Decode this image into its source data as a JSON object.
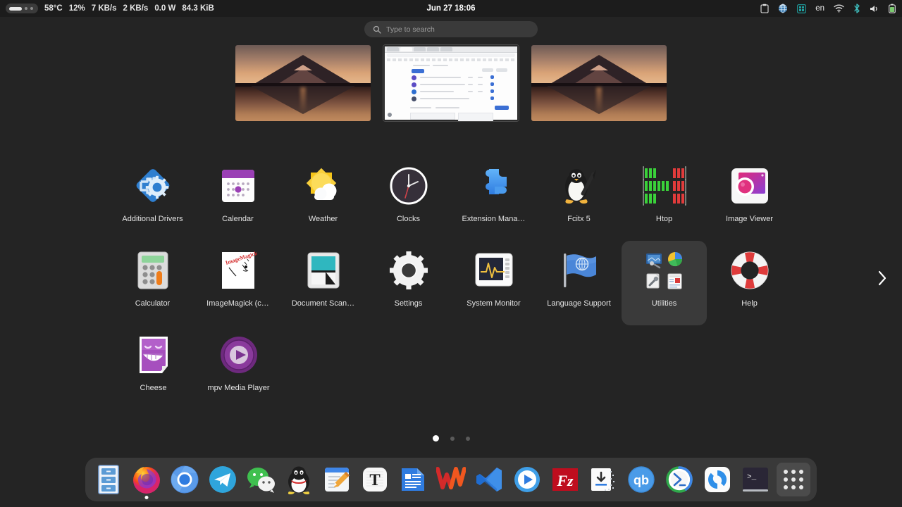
{
  "topbar": {
    "workspace_indicator": "workspace-switcher",
    "stats": [
      {
        "name": "cpu-temperature",
        "value": "58°C"
      },
      {
        "name": "cpu-usage",
        "value": "12%"
      },
      {
        "name": "net-download-speed",
        "value": "7 KB/s"
      },
      {
        "name": "net-upload-speed",
        "value": "2 KB/s"
      },
      {
        "name": "power-draw",
        "value": "0.0 W"
      },
      {
        "name": "memory-usage",
        "value": "84.3 KiB"
      }
    ],
    "clock": "Jun 27  18:06",
    "tray": {
      "clipboard": "clipboard-icon",
      "globe": "network-globe-icon",
      "grid": "extension-grid-icon",
      "language": "en",
      "wifi": "wifi-icon",
      "bluetooth": "bluetooth-icon",
      "volume": "volume-icon",
      "battery": "battery-icon"
    }
  },
  "search": {
    "placeholder": "Type to search",
    "icon": "search-icon"
  },
  "workspaces": [
    {
      "name": "workspace-1",
      "content": "wallpaper",
      "active": false
    },
    {
      "name": "workspace-2",
      "content": "browser-window",
      "active": true
    },
    {
      "name": "workspace-3",
      "content": "wallpaper",
      "active": false
    }
  ],
  "apps": {
    "rows": [
      [
        {
          "label": "Additional Drivers",
          "icon": "additional-drivers-icon",
          "type": "app"
        },
        {
          "label": "Calendar",
          "icon": "calendar-icon",
          "type": "app"
        },
        {
          "label": "Weather",
          "icon": "weather-icon",
          "type": "app"
        },
        {
          "label": "Clocks",
          "icon": "clocks-icon",
          "type": "app"
        },
        {
          "label": "Extension Mana…",
          "icon": "extension-manager-icon",
          "type": "app"
        },
        {
          "label": "Fcitx 5",
          "icon": "fcitx5-icon",
          "type": "app"
        },
        {
          "label": "Htop",
          "icon": "htop-icon",
          "type": "app"
        },
        {
          "label": "Image Viewer",
          "icon": "image-viewer-icon",
          "type": "app"
        }
      ],
      [
        {
          "label": "Calculator",
          "icon": "calculator-icon",
          "type": "app"
        },
        {
          "label": "ImageMagick (c…",
          "icon": "imagemagick-icon",
          "type": "app"
        },
        {
          "label": "Document Scan…",
          "icon": "document-scanner-icon",
          "type": "app"
        },
        {
          "label": "Settings",
          "icon": "settings-icon",
          "type": "app"
        },
        {
          "label": "System Monitor",
          "icon": "system-monitor-icon",
          "type": "app"
        },
        {
          "label": "Language Support",
          "icon": "language-support-icon",
          "type": "app"
        },
        {
          "label": "Utilities",
          "icon": "utilities-folder-icon",
          "type": "folder"
        },
        {
          "label": "Help",
          "icon": "help-icon",
          "type": "app"
        }
      ],
      [
        {
          "label": "Cheese",
          "icon": "cheese-icon",
          "type": "app"
        },
        {
          "label": "mpv Media Player",
          "icon": "mpv-icon",
          "type": "app"
        }
      ]
    ]
  },
  "pagination": {
    "pages": 3,
    "current": 1,
    "next_label": "next-page"
  },
  "dock": {
    "items": [
      {
        "name": "files",
        "icon": "files-icon",
        "running": false
      },
      {
        "name": "firefox",
        "icon": "firefox-icon",
        "running": true
      },
      {
        "name": "chromium",
        "icon": "chromium-icon",
        "running": false
      },
      {
        "name": "telegram",
        "icon": "telegram-icon",
        "running": false
      },
      {
        "name": "wechat",
        "icon": "wechat-icon",
        "running": false
      },
      {
        "name": "qq",
        "icon": "qq-icon",
        "running": false
      },
      {
        "name": "text-editor",
        "icon": "text-editor-icon",
        "running": false
      },
      {
        "name": "typora",
        "icon": "typora-icon",
        "running": false
      },
      {
        "name": "libreoffice-writer",
        "icon": "libreoffice-writer-icon",
        "running": false
      },
      {
        "name": "wps-office",
        "icon": "wps-office-icon",
        "running": false
      },
      {
        "name": "vs-code",
        "icon": "vscode-icon",
        "running": false
      },
      {
        "name": "media-player",
        "icon": "media-player-icon",
        "running": false
      },
      {
        "name": "filezilla",
        "icon": "filezilla-icon",
        "running": false
      },
      {
        "name": "download-manager",
        "icon": "download-manager-icon",
        "running": false
      },
      {
        "name": "qbittorrent",
        "icon": "qbittorrent-icon",
        "running": false
      },
      {
        "name": "remmina",
        "icon": "remmina-icon",
        "running": false
      },
      {
        "name": "onlyoffice",
        "icon": "onlyoffice-icon",
        "running": false
      },
      {
        "name": "terminal",
        "icon": "terminal-icon",
        "running": false
      }
    ],
    "show_apps_label": "show-applications"
  },
  "colors": {
    "bg": "#242424",
    "topbar": "#1c1c1c",
    "dock": "#3c3c3c",
    "accent": "#3584e4",
    "label": "#e3e3e3"
  }
}
